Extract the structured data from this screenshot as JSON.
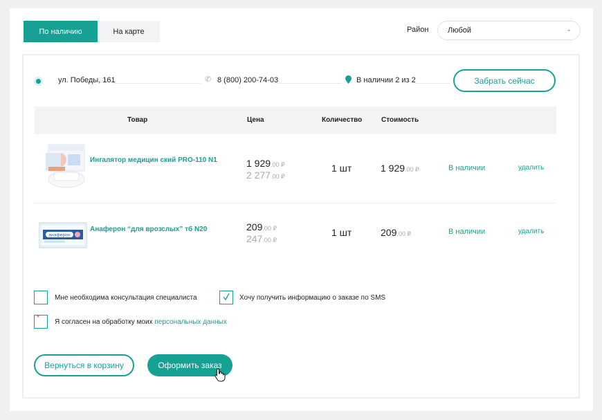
{
  "tabs": {
    "in_stock": "По наличию",
    "on_map": "На карте"
  },
  "region": {
    "label": "Район",
    "value": "Любой"
  },
  "store": {
    "address": "ул. Победы, 161",
    "phone": "8 (800) 200-74-03",
    "availability": "В наличии 2 из 2",
    "pickup_button": "Забрать сейчас"
  },
  "table": {
    "headers": {
      "product": "Товар",
      "price": "Цена",
      "quantity": "Количество",
      "cost": "Стоимость"
    },
    "rows": [
      {
        "name": "Ингалятор медицин ский PRO-110 N1",
        "price_int": "1 929",
        "price_dec": ".00 ₽",
        "old_price_int": "2 277",
        "old_price_dec": ".00 ₽",
        "quantity": "1 шт",
        "cost_int": "1 929",
        "cost_dec": ".00 ₽",
        "status": "В наличии",
        "delete": "удалить"
      },
      {
        "name": "Анаферон “для врозслых” тб N20",
        "price_int": "209",
        "price_dec": ".00 ₽",
        "old_price_int": "247",
        "old_price_dec": ".00 ₽",
        "quantity": "1 шт",
        "cost_int": "209",
        "cost_dec": ".00 ₽",
        "status": "В наличии",
        "delete": "удалить"
      }
    ]
  },
  "options": {
    "consultation": "Мне необходима консультация специалиста",
    "sms": "Хочу получить информацию о заказе по SMS",
    "consent_prefix": "Я согласен на обработку моих ",
    "consent_link": "персональных данных",
    "consent_required_mark": "*"
  },
  "actions": {
    "back": "Вернуться в корзину",
    "checkout": "Оформить заказ"
  },
  "colors": {
    "accent": "#17a195",
    "background": "#eef0f2",
    "header_bg": "#f2f3f4"
  }
}
